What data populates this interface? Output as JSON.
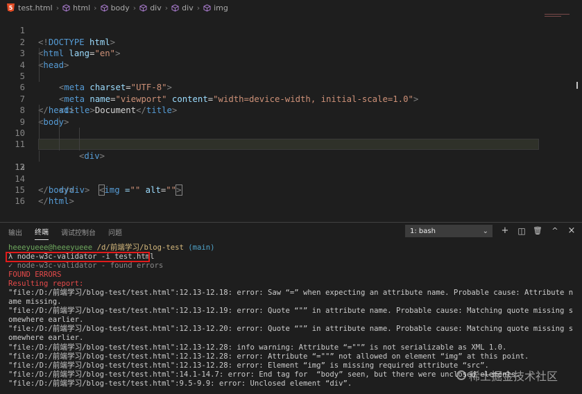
{
  "breadcrumb": {
    "file": "test.html",
    "items": [
      "html",
      "body",
      "div",
      "div",
      "img"
    ]
  },
  "editor": {
    "line_numbers": [
      "1",
      "2",
      "3",
      "4",
      "5",
      "6",
      "7",
      "8",
      "9",
      "10",
      "11",
      "12",
      "13",
      "14",
      "15",
      "16"
    ],
    "lines": {
      "l1": {
        "a": "<!",
        "b": "DOCTYPE",
        "c": " html",
        "d": ">"
      },
      "l2": {
        "a": "<",
        "b": "html",
        "c": " lang",
        "d": "=",
        "e": "\"en\"",
        "f": ">"
      },
      "l3": {
        "a": "<",
        "b": "head",
        "c": ">"
      },
      "l4": {
        "a": "<",
        "b": "meta",
        "c": " charset",
        "d": "=",
        "e": "\"UTF-8\"",
        "f": ">"
      },
      "l5": {
        "a": "<",
        "b": "meta",
        "c": " name",
        "d": "=",
        "e": "\"viewport\"",
        "f": " content",
        "g": "=",
        "h": "\"width=device-width, initial-scale=1.0\"",
        "i": ">"
      },
      "l6": {
        "a": "<",
        "b": "title",
        "c": ">",
        "d": "Document",
        "e": "</",
        "f": "title",
        "g": ">"
      },
      "l7": {
        "a": "</",
        "b": "head",
        "c": ">"
      },
      "l8": {
        "a": "<",
        "b": "body",
        "c": ">"
      },
      "l9": {
        "a": "<",
        "b": "div",
        "c": ">"
      },
      "l10": {
        "a": "<",
        "b": "div",
        "c": ">"
      },
      "l12": {
        "a": "<",
        "b": "img",
        "c": " =",
        "d": "\"\"",
        "e": " alt",
        "f": "=",
        "g": "\"\"",
        "h": ">"
      },
      "l13": {
        "a": "</",
        "b": "div",
        "c": ">"
      },
      "l14": {
        "a": "</",
        "b": "body",
        "c": ">"
      },
      "l15": {
        "a": "</",
        "b": "html",
        "c": ">"
      }
    }
  },
  "panel": {
    "tabs": [
      "输出",
      "终端",
      "调试控制台",
      "问题"
    ],
    "active_tab": "终端",
    "terminal_select": "1: bash",
    "icons": {
      "add": "+",
      "split": "◫",
      "trash": "🗑",
      "maximize": "^",
      "close": "×"
    }
  },
  "terminal": {
    "prompt_user": "heeeyueee@heeeyueee",
    "prompt_path": "/d/前端学习/blog-test",
    "prompt_branch": "(main)",
    "command": "λ node-w3c-validator -i test.html",
    "spinner_line": "✓ node-w3c-validator - found errors",
    "found_errors": "FOUND ERRORS",
    "resulting": "Resulting report:",
    "errors": [
      "\"file:/D:/前端学习/blog-test/test.html\":12.13-12.18: error: Saw “=” when expecting an attribute name. Probable cause: Attribute name missing.",
      "\"file:/D:/前端学习/blog-test/test.html\":12.13-12.19: error: Quote “\"” in attribute name. Probable cause: Matching quote missing somewhere earlier.",
      "\"file:/D:/前端学习/blog-test/test.html\":12.13-12.20: error: Quote “\"” in attribute name. Probable cause: Matching quote missing somewhere earlier.",
      "\"file:/D:/前端学习/blog-test/test.html\":12.13-12.28: info warning: Attribute “=\"\"” is not serializable as XML 1.0.",
      "\"file:/D:/前端学习/blog-test/test.html\":12.13-12.28: error: Attribute “=\"\"” not allowed on element “img” at this point.",
      "\"file:/D:/前端学习/blog-test/test.html\":12.13-12.28: error: Element “img” is missing required attribute “src”.",
      "\"file:/D:/前端学习/blog-test/test.html\":14.1-14.7: error: End tag for  “body” seen, but there were unclosed elements.",
      "\"file:/D:/前端学习/blog-test/test.html\":9.5-9.9: error: Unclosed element “div”."
    ]
  },
  "watermark": "稀土掘金技术社区",
  "colors": {
    "background": "#1e1e1e",
    "tag": "#569cd6",
    "attr": "#9cdcfe",
    "string": "#ce9178",
    "error_box": "#e11b1b"
  }
}
